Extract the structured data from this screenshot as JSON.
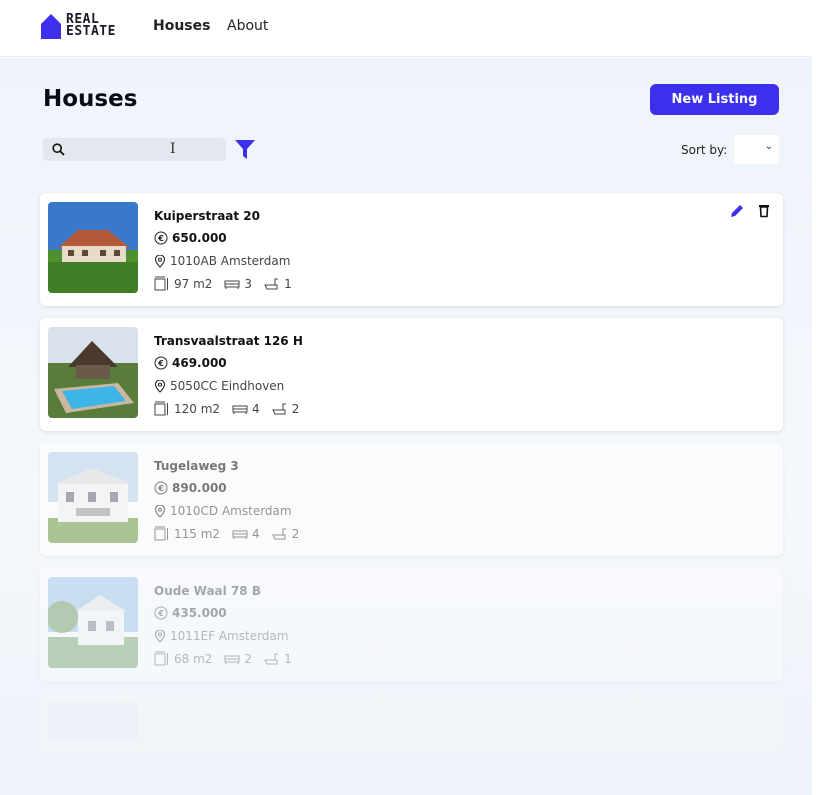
{
  "nav": {
    "logo_line1": "REAL",
    "logo_line2": "ESTATE",
    "links": [
      "Houses",
      "About"
    ]
  },
  "page": {
    "title": "Houses",
    "new_listing_label": "New Listing",
    "search_placeholder": "",
    "sort_label": "Sort by:",
    "sort_value": ""
  },
  "colors": {
    "accent": "#3d30ec",
    "background": "#f1f5fb"
  },
  "listings": [
    {
      "title": "Kuiperstraat 20",
      "price": "650.000",
      "address": "1010AB Amsterdam",
      "size": "97 m2",
      "bedrooms": "3",
      "bathrooms": "1",
      "editable": true
    },
    {
      "title": "Transvaalstraat 126 H",
      "price": "469.000",
      "address": "5050CC Eindhoven",
      "size": "120 m2",
      "bedrooms": "4",
      "bathrooms": "2",
      "editable": false
    },
    {
      "title": "Tugelaweg 3",
      "price": "890.000",
      "address": "1010CD Amsterdam",
      "size": "115 m2",
      "bedrooms": "4",
      "bathrooms": "2",
      "editable": false
    },
    {
      "title": "Oude Waal 78 B",
      "price": "435.000",
      "address": "1011EF Amsterdam",
      "size": "68 m2",
      "bedrooms": "2",
      "bathrooms": "1",
      "editable": false
    }
  ]
}
